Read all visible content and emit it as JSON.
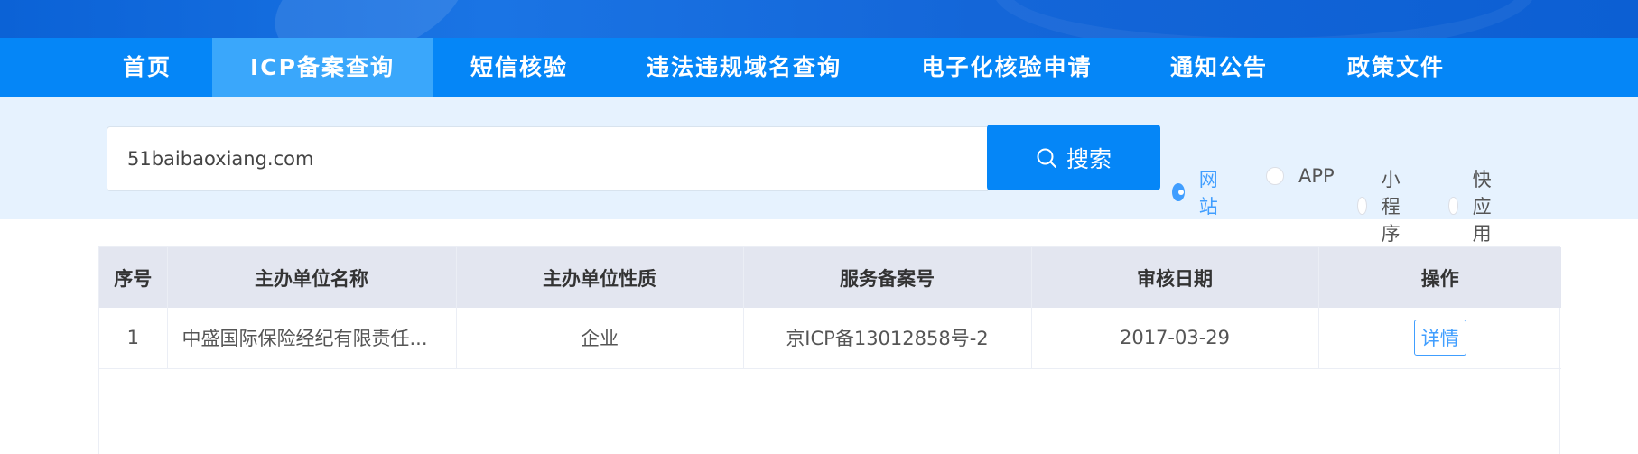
{
  "nav": {
    "items": [
      {
        "label": "首页"
      },
      {
        "label": "ICP备案查询",
        "active": true
      },
      {
        "label": "短信核验"
      },
      {
        "label": "违法违规域名查询"
      },
      {
        "label": "电子化核验申请"
      },
      {
        "label": "通知公告"
      },
      {
        "label": "政策文件"
      }
    ]
  },
  "search": {
    "value": "51baibaoxiang.com",
    "button_label": "搜索",
    "button_icon": "search-icon"
  },
  "types": {
    "options": [
      "网站",
      "APP",
      "小程序",
      "快应用"
    ],
    "selected": "网站"
  },
  "table": {
    "headers": [
      "序号",
      "主办单位名称",
      "主办单位性质",
      "服务备案号",
      "审核日期",
      "操作"
    ],
    "rows": [
      {
        "index": "1",
        "org_name": "中盛国际保险经纪有限责任...",
        "org_type": "企业",
        "icp_number": "京ICP备13012858号-2",
        "review_date": "2017-03-29",
        "action_label": "详情"
      }
    ]
  },
  "colors": {
    "nav_bg": "#0586f7",
    "nav_active": "#3aa7fb",
    "accent": "#409eff"
  }
}
